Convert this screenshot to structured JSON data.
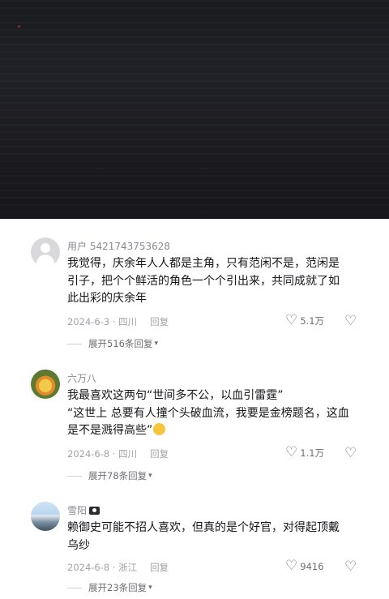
{
  "comments": [
    {
      "username": "用户 5421743753628",
      "lines": [
        "我觉得，庆余年人人都是主角，只有范闲不是，范闲是",
        "引子，把个个鲜活的角色一个个引出来，共同成就了如",
        "此出彩的庆余年"
      ],
      "date_location": "2024-6-3 · 四川",
      "reply_label": "回复",
      "likes": "5.1万",
      "expand_label": "展开516条回复"
    },
    {
      "username": "六万八",
      "lines": [
        "我最喜欢这两句“世间多不公，以血引雷霆”",
        "“这世上 总要有人撞个头破血流，我要是金榜题名，这血",
        "是不是溅得高些”"
      ],
      "date_location": "2024-6-8 · 四川",
      "reply_label": "回复",
      "likes": "1.1万",
      "expand_label": "展开78条回复"
    },
    {
      "username": "雪阳",
      "lines": [
        "赖御史可能不招人喜欢，但真的是个好官，对得起顶戴",
        "乌纱"
      ],
      "date_location": "2024-6-8 · 浙江",
      "reply_label": "回复",
      "likes": "9416",
      "expand_label": "展开23条回复"
    }
  ]
}
